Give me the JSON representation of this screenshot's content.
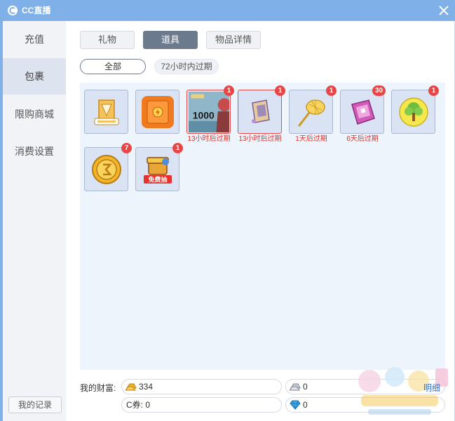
{
  "app": {
    "title": "CC直播"
  },
  "sidebar": {
    "items": [
      {
        "label": "充值"
      },
      {
        "label": "包裹"
      },
      {
        "label": "限购商城"
      },
      {
        "label": "消费设置"
      }
    ],
    "record_label": "我的记录"
  },
  "tabs": [
    {
      "label": "礼物"
    },
    {
      "label": "道具"
    },
    {
      "label": "物品详情"
    }
  ],
  "filters": [
    {
      "label": "全部"
    },
    {
      "label": "72小时内过期"
    }
  ],
  "items": [
    {
      "icon": "ticket-icon",
      "badge": "",
      "expire": ""
    },
    {
      "icon": "red-envelope-icon",
      "badge": "",
      "expire": ""
    },
    {
      "icon": "card-1000-icon",
      "card_text": "1000",
      "badge": "1",
      "expire": "13小时后过期"
    },
    {
      "icon": "scroll-icon",
      "badge": "1",
      "expire": "13小时后过期"
    },
    {
      "icon": "butterfly-net-icon",
      "badge": "1",
      "expire": "1天后过期"
    },
    {
      "icon": "book-icon",
      "badge": "30",
      "expire": "6天后过期"
    },
    {
      "icon": "tree-icon",
      "badge": "1",
      "expire": ""
    },
    {
      "icon": "gold-coin-icon",
      "badge": "7",
      "expire": ""
    },
    {
      "icon": "free-draw-icon",
      "free_label": "免费抽",
      "badge": "1",
      "expire": ""
    }
  ],
  "wealth": {
    "label": "我的财富:",
    "gold": "334",
    "silver": "0",
    "c_coupon": "C券: 0",
    "diamond": "0",
    "detail_label": "明细"
  },
  "colors": {
    "titlebar": "#7fb0e8",
    "badge": "#e84646",
    "expire_text": "#d9342b",
    "active_tab": "#6c7a8d"
  }
}
